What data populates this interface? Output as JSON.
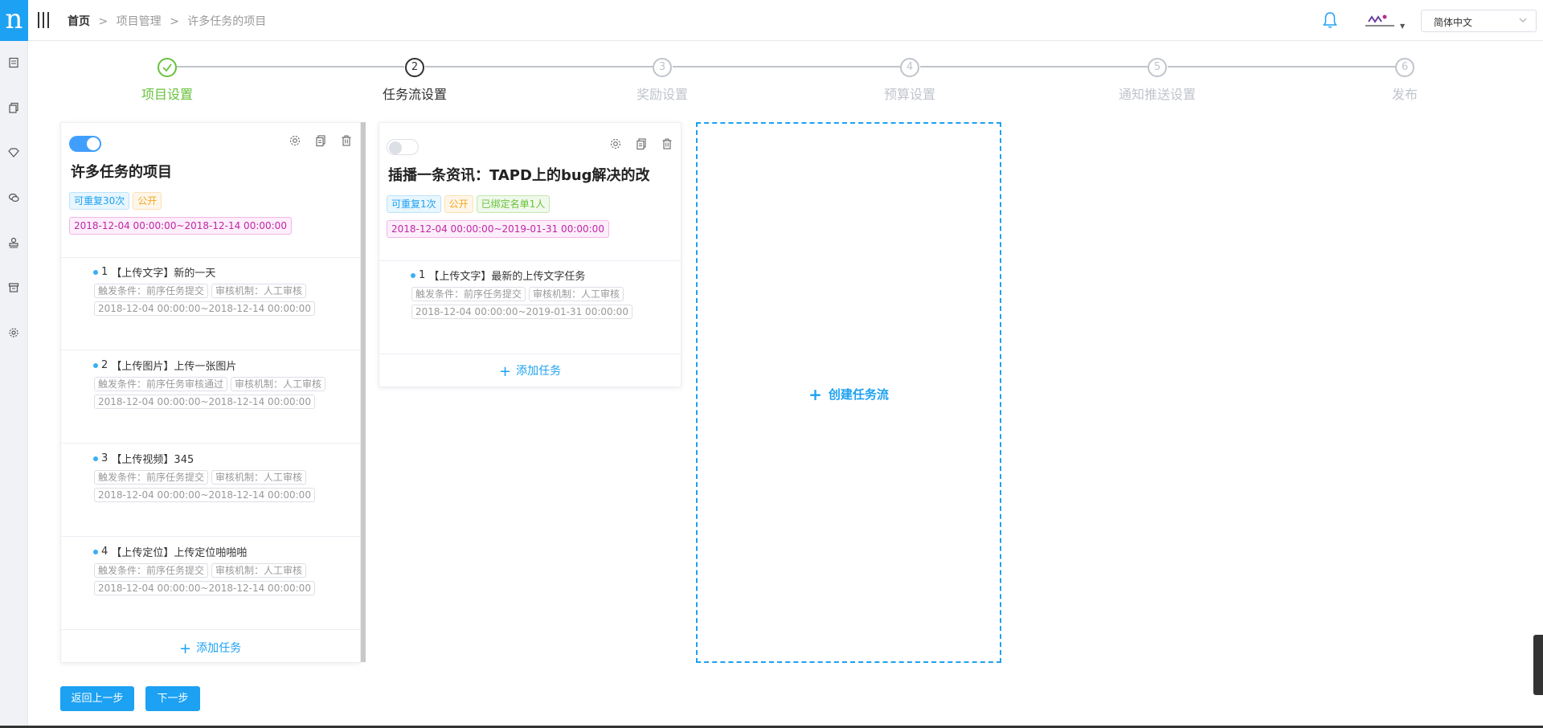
{
  "logo": {
    "letter": "n"
  },
  "sidebar": {
    "icons": [
      "document-icon",
      "copy-icon",
      "diamond-icon",
      "chat-icon",
      "stamp-icon",
      "archive-icon",
      "settings-icon"
    ]
  },
  "breadcrumb": {
    "home": "首页",
    "sep": ">",
    "project_mgmt": "项目管理",
    "current": "许多任务的项目"
  },
  "header": {
    "language": "简体中文"
  },
  "steps": [
    {
      "index": "1",
      "label": "项目设置",
      "state": "done"
    },
    {
      "index": "2",
      "label": "任务流设置",
      "state": "active"
    },
    {
      "index": "3",
      "label": "奖励设置",
      "state": "pending"
    },
    {
      "index": "4",
      "label": "预算设置",
      "state": "pending"
    },
    {
      "index": "5",
      "label": "通知推送设置",
      "state": "pending"
    },
    {
      "index": "6",
      "label": "发布",
      "state": "pending"
    }
  ],
  "flows": [
    {
      "enabled": true,
      "title": "许多任务的项目",
      "tags": [
        {
          "text": "可重复30次",
          "color": "blue"
        },
        {
          "text": "公开",
          "color": "orange"
        }
      ],
      "date_range": "2018-12-04 00:00:00~2018-12-14 00:00:00",
      "tasks": [
        {
          "num": "1",
          "title": "【上传文字】新的一天",
          "trigger": "触发条件：前序任务提交",
          "review": "审核机制：人工审核",
          "range": "2018-12-04 00:00:00~2018-12-14 00:00:00"
        },
        {
          "num": "2",
          "title": "【上传图片】上传一张图片",
          "trigger": "触发条件：前序任务审核通过",
          "review": "审核机制：人工审核",
          "range": "2018-12-04 00:00:00~2018-12-14 00:00:00"
        },
        {
          "num": "3",
          "title": "【上传视频】345",
          "trigger": "触发条件：前序任务提交",
          "review": "审核机制：人工审核",
          "range": "2018-12-04 00:00:00~2018-12-14 00:00:00"
        },
        {
          "num": "4",
          "title": "【上传定位】上传定位啪啪啪",
          "trigger": "触发条件：前序任务提交",
          "review": "审核机制：人工审核",
          "range": "2018-12-04 00:00:00~2018-12-14 00:00:00"
        }
      ],
      "add_task": "添加任务"
    },
    {
      "enabled": false,
      "title": "插播一条资讯：TAPD上的bug解决的改",
      "tags": [
        {
          "text": "可重复1次",
          "color": "blue"
        },
        {
          "text": "公开",
          "color": "orange"
        },
        {
          "text": "已绑定名单1人",
          "color": "green"
        }
      ],
      "date_range": "2018-12-04 00:00:00~2019-01-31 00:00:00",
      "tasks": [
        {
          "num": "1",
          "title": "【上传文字】最新的上传文字任务",
          "trigger": "触发条件：前序任务提交",
          "review": "审核机制：人工审核",
          "range": "2018-12-04 00:00:00~2019-01-31 00:00:00"
        }
      ],
      "add_task": "添加任务"
    }
  ],
  "create_flow": "创建任务流",
  "buttons": {
    "back": "返回上一步",
    "next": "下一步"
  },
  "colors": {
    "accent": "#1da1f2",
    "done": "#67c23a",
    "active": "#303133",
    "pending": "#c0c4cc"
  }
}
